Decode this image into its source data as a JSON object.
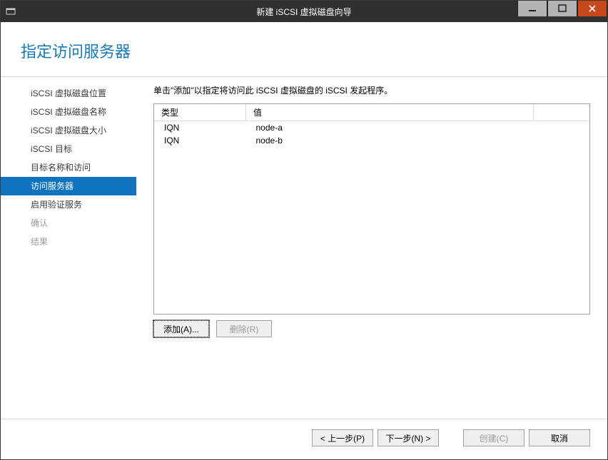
{
  "window": {
    "title": "新建 iSCSI 虚拟磁盘向导"
  },
  "header": {
    "title": "指定访问服务器"
  },
  "sidebar": {
    "items": [
      {
        "label": "iSCSI 虚拟磁盘位置",
        "state": "normal"
      },
      {
        "label": "iSCSI 虚拟磁盘名称",
        "state": "normal"
      },
      {
        "label": "iSCSI 虚拟磁盘大小",
        "state": "normal"
      },
      {
        "label": "iSCSI 目标",
        "state": "normal"
      },
      {
        "label": "目标名称和访问",
        "state": "normal"
      },
      {
        "label": "访问服务器",
        "state": "active"
      },
      {
        "label": "启用验证服务",
        "state": "normal"
      },
      {
        "label": "确认",
        "state": "disabled"
      },
      {
        "label": "结果",
        "state": "disabled"
      }
    ]
  },
  "content": {
    "instruction": "单击\"添加\"以指定将访问此 iSCSI 虚拟磁盘的 iSCSI 发起程序。",
    "table": {
      "headers": {
        "type": "类型",
        "value": "值"
      },
      "rows": [
        {
          "type": "IQN",
          "value": "node-a"
        },
        {
          "type": "IQN",
          "value": "node-b"
        }
      ]
    },
    "buttons": {
      "add": "添加(A)...",
      "remove": "删除(R)"
    }
  },
  "footer": {
    "previous": "< 上一步(P)",
    "next": "下一步(N) >",
    "create": "创建(C)",
    "cancel": "取消"
  }
}
